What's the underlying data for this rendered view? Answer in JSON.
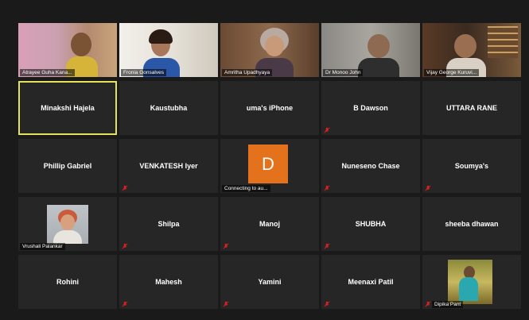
{
  "colors": {
    "background": "#1a1a1a",
    "tile": "#262626",
    "active_border": "#e3e35a",
    "mute_icon": "#e02020",
    "avatar_d": "#e4721c"
  },
  "row1": [
    {
      "name": "Atrayee Guha Kana..."
    },
    {
      "name": "Fronia Gonsalves"
    },
    {
      "name": "Amritha Upadhyaya"
    },
    {
      "name": "Dr Monoo John"
    },
    {
      "name": "Vijay George Kuruvi..."
    }
  ],
  "row2": [
    {
      "name": "Minakshi Hajela"
    },
    {
      "name": "Kaustubha"
    },
    {
      "name": "uma's iPhone"
    },
    {
      "name": "B Dawson"
    },
    {
      "name": "UTTARA RANE"
    }
  ],
  "row3": [
    {
      "name": "Phillip Gabriel"
    },
    {
      "name": "VENKATESH Iyer"
    },
    {
      "name": "Connecting to au...",
      "avatar": "D"
    },
    {
      "name": "Nuneseno Chase"
    },
    {
      "name": "Soumya's"
    }
  ],
  "row4": [
    {
      "name": "Vrushali Palankar"
    },
    {
      "name": "Shilpa"
    },
    {
      "name": "Manoj"
    },
    {
      "name": "SHUBHA"
    },
    {
      "name": "sheeba dhawan"
    }
  ],
  "row5": [
    {
      "name": "Rohini"
    },
    {
      "name": "Mahesh"
    },
    {
      "name": "Yamini"
    },
    {
      "name": "Meenaxi Patil"
    },
    {
      "name": "Dipika Pant"
    }
  ]
}
